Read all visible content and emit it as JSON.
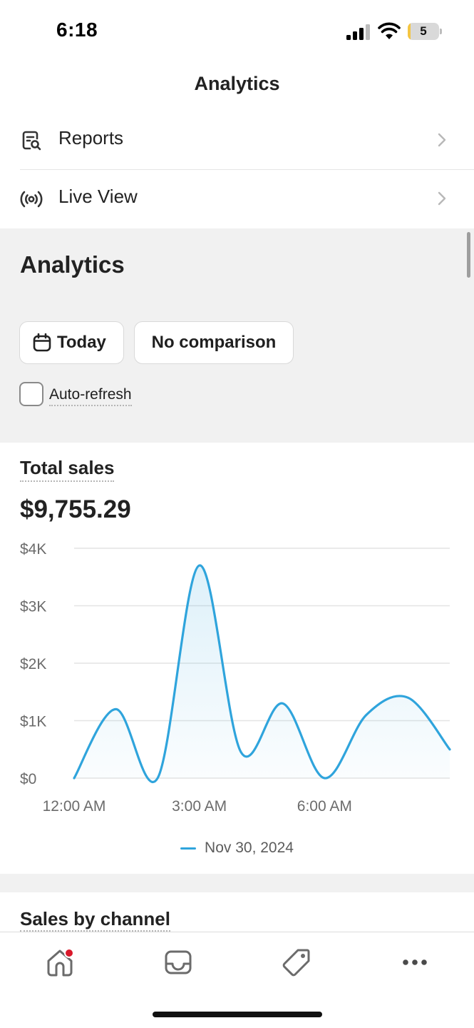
{
  "status_bar": {
    "time": "6:18",
    "battery_level": "5",
    "battery_percent": 5
  },
  "header": {
    "title": "Analytics"
  },
  "menu": [
    {
      "label": "Reports",
      "icon": "report-search-icon"
    },
    {
      "label": "Live View",
      "icon": "live-broadcast-icon"
    }
  ],
  "analytics": {
    "title": "Analytics",
    "date_filter_label": "Today",
    "comparison_label": "No comparison",
    "auto_refresh_label": "Auto-refresh",
    "auto_refresh_checked": false
  },
  "total_sales": {
    "title": "Total sales",
    "value": "$9,755.29"
  },
  "chart_data": {
    "type": "line",
    "title": "Total sales",
    "y_ticks": [
      "$0",
      "$1K",
      "$2K",
      "$3K",
      "$4K"
    ],
    "ylim": [
      0,
      4000
    ],
    "x_ticks": [
      "12:00 AM",
      "3:00 AM",
      "6:00 AM"
    ],
    "grid": true,
    "legend_position": "bottom",
    "series": [
      {
        "name": "Nov 30, 2024",
        "color": "#2fa4dc",
        "x": [
          "12:00 AM",
          "1:00 AM",
          "2:00 AM",
          "3:00 AM",
          "4:00 AM",
          "5:00 AM",
          "6:00 AM",
          "7:00 AM",
          "8:00 AM",
          "9:00 AM"
        ],
        "values": [
          0,
          1200,
          0,
          3700,
          450,
          1300,
          0,
          1100,
          1400,
          500
        ]
      }
    ]
  },
  "sales_by_channel": {
    "title": "Sales by channel"
  },
  "tab_bar": {
    "tabs": [
      {
        "name": "home",
        "icon": "home-icon",
        "has_notification": true
      },
      {
        "name": "orders",
        "icon": "inbox-icon"
      },
      {
        "name": "products",
        "icon": "tag-icon"
      },
      {
        "name": "more",
        "icon": "more-dots-icon"
      }
    ]
  }
}
